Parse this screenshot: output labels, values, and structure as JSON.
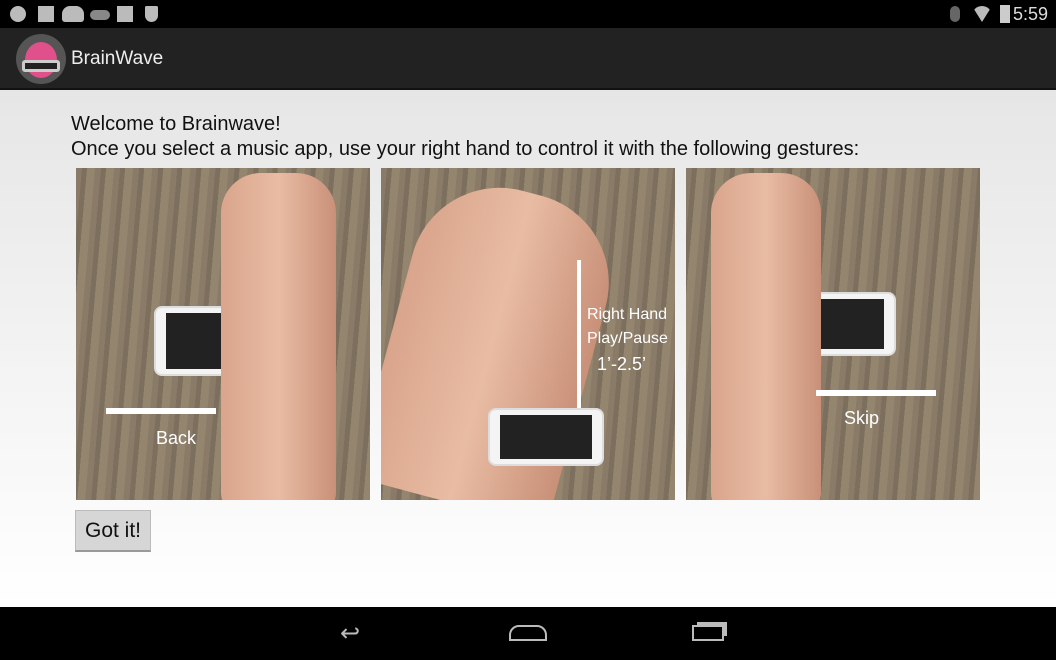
{
  "status_bar": {
    "icons": [
      "check-cloud-icon",
      "image-icon",
      "cloud-upload-icon",
      "cloud-icon",
      "shopping-bag-check-icon",
      "shield-alert-icon"
    ],
    "right_icons": [
      "bluetooth-icon",
      "wifi-icon",
      "battery-icon"
    ],
    "time": "5:59"
  },
  "action_bar": {
    "title": "BrainWave"
  },
  "main": {
    "welcome": "Welcome to Brainwave!",
    "instructions": "Once you select a music app, use your right hand to control it with the following gestures:",
    "gestures": [
      {
        "label": "Back"
      },
      {
        "label_line1": "Right Hand",
        "label_line2": "Play/Pause",
        "distance": "1’-2.5’"
      },
      {
        "label": "Skip"
      }
    ],
    "got_it_label": "Got it!"
  },
  "nav_bar": {
    "buttons": [
      "back",
      "home",
      "recent-apps"
    ]
  }
}
